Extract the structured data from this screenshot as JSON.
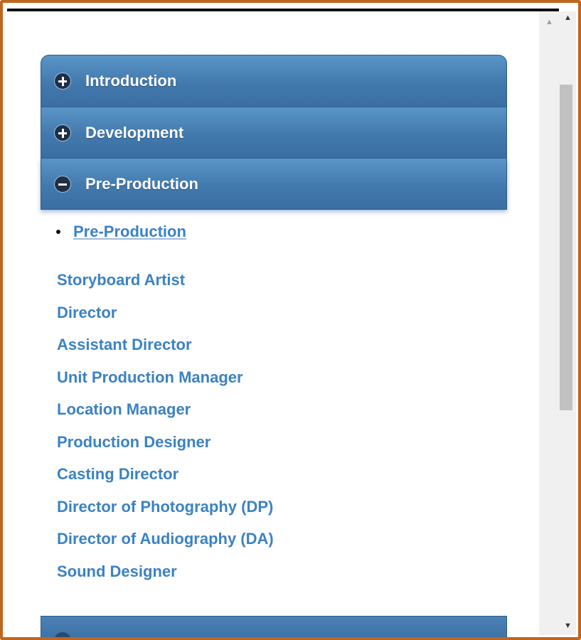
{
  "accordion": {
    "sections": [
      {
        "label": "Introduction",
        "icon": "plus-circle-icon",
        "state": "collapsed"
      },
      {
        "label": "Development",
        "icon": "plus-circle-icon",
        "state": "collapsed"
      },
      {
        "label": "Pre-Production",
        "icon": "minus-circle-icon",
        "state": "expanded"
      }
    ],
    "open_panel": {
      "link": "Pre-Production",
      "roles": [
        "Storyboard Artist",
        "Director",
        "Assistant Director",
        "Unit Production Manager",
        "Location Manager",
        "Production Designer",
        "Casting Director",
        "Director of Photography (DP)",
        "Director of Audiography (DA)",
        "Sound Designer"
      ]
    }
  },
  "colors": {
    "frame_border": "#c0651e",
    "header_blue": "#4279ad",
    "link_blue": "#3b82c4"
  },
  "scrollbar": {
    "up_arrow": "▲",
    "down_arrow": "▼"
  }
}
